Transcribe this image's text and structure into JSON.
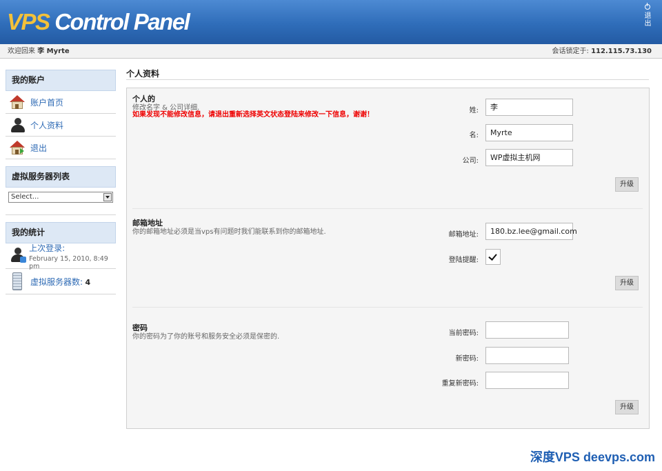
{
  "header": {
    "logo_accent": "VPS",
    "logo_main": " Control Panel",
    "logout_label": "退出"
  },
  "subbar": {
    "welcome_prefix": "欢迎回来",
    "user_name": "李 Myrte",
    "session_label": "会话锁定于:",
    "session_ip": "112.115.73.130"
  },
  "sidebar": {
    "account_title": "我的账户",
    "account_items": [
      {
        "label": "账户首页",
        "icon": "home-icon"
      },
      {
        "label": "个人资料",
        "icon": "user-icon"
      },
      {
        "label": "退出",
        "icon": "exit-house-icon"
      }
    ],
    "servers_title": "虚拟服务器列表",
    "servers_select": "Select...",
    "stats_title": "我的统计",
    "last_login_label": "上次登录:",
    "last_login_value": "February 15, 2010, 8:49 pm",
    "server_count_label": "虚拟服务器数:",
    "server_count_value": "4"
  },
  "main": {
    "page_title": "个人资料",
    "personal": {
      "title": "个人的",
      "desc": "修改名字 & 公司详细.",
      "warning": "如果发现不能修改信息，请退出重新选择英文状态登陆来修改一下信息，谢谢！",
      "surname_label": "姓:",
      "surname_value": "李",
      "name_label": "名:",
      "name_value": "Myrte",
      "company_label": "公司:",
      "company_value": "WP虚拟主机网",
      "submit": "升级"
    },
    "email": {
      "title": "邮箱地址",
      "desc": "你的邮箱地址必须是当vps有问题时我们能联系到你的邮箱地址.",
      "email_label": "邮箱地址:",
      "email_value": "180.bz.lee@gmail.com",
      "reminder_label": "登陆提醒:",
      "reminder_checked": true,
      "submit": "升级"
    },
    "password": {
      "title": "密码",
      "desc": "你的密码为了你的账号和服务安全必须是保密的.",
      "current_label": "当前密码:",
      "new_label": "新密码:",
      "repeat_label": "重复新密码:",
      "submit": "升级"
    }
  },
  "watermark": "深度VPS deevps.com"
}
